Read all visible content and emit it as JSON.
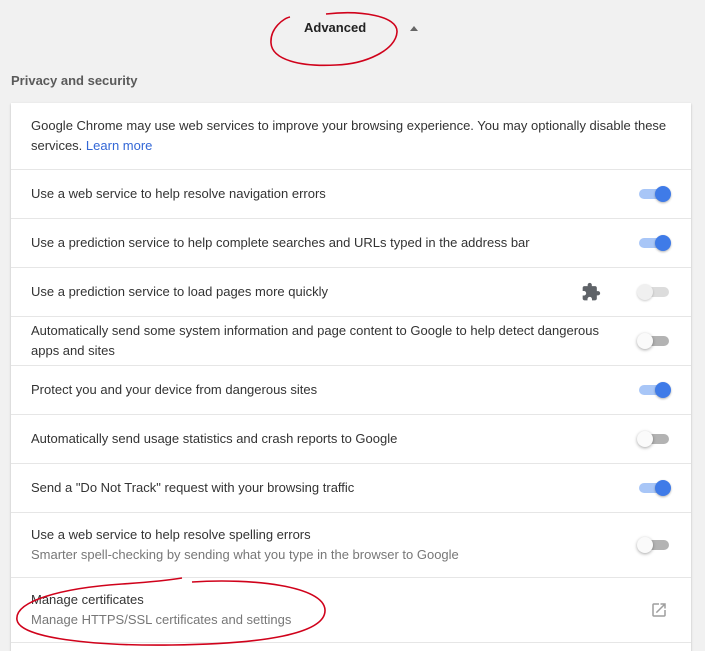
{
  "advanced": {
    "label": "Advanced"
  },
  "section": {
    "title": "Privacy and security"
  },
  "intro": {
    "text": "Google Chrome may use web services to improve your browsing experience. You may optionally disable these services.",
    "learn_more": "Learn more"
  },
  "settings": [
    {
      "label": "Use a web service to help resolve navigation errors",
      "enabled": true
    },
    {
      "label": "Use a prediction service to help complete searches and URLs typed in the address bar",
      "enabled": true
    },
    {
      "label": "Use a prediction service to load pages more quickly",
      "enabled": false,
      "extension_controlled": true
    },
    {
      "label": "Automatically send some system information and page content to Google to help detect dangerous apps and sites",
      "enabled": false
    },
    {
      "label": "Protect you and your device from dangerous sites",
      "enabled": true
    },
    {
      "label": "Automatically send usage statistics and crash reports to Google",
      "enabled": false
    },
    {
      "label": "Send a \"Do Not Track\" request with your browsing traffic",
      "enabled": true
    },
    {
      "label": "Use a web service to help resolve spelling errors",
      "sublabel": "Smarter spell-checking by sending what you type in the browser to Google",
      "enabled": false
    }
  ],
  "certificates": {
    "title": "Manage certificates",
    "subtitle": "Manage HTTPS/SSL certificates and settings"
  },
  "colors": {
    "accent": "#3f7be8",
    "annotation": "#d0021b"
  }
}
